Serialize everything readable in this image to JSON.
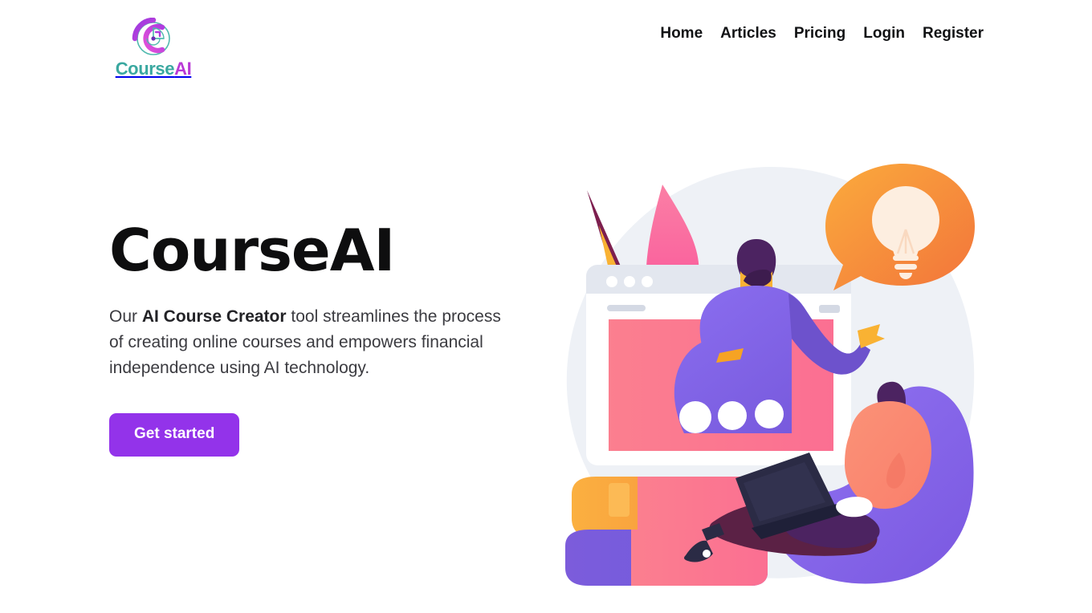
{
  "brand": {
    "logo_icon": "courseai-circular-logo-icon",
    "word_primary": "Course",
    "word_accent": "AI",
    "color_primary": "#3aa8a0",
    "color_accent": "#b939d6"
  },
  "nav": {
    "items": [
      {
        "label": "Home"
      },
      {
        "label": "Articles"
      },
      {
        "label": "Pricing"
      },
      {
        "label": "Login"
      },
      {
        "label": "Register"
      }
    ]
  },
  "hero": {
    "title": "CourseAI",
    "paragraph_prefix": "Our ",
    "paragraph_bold": "AI Course Creator",
    "paragraph_suffix": " tool streamlines the process of creating online courses and empowers financial independence using AI technology.",
    "cta_label": "Get started",
    "cta_color": "#9333ea",
    "illustration": {
      "name": "online-course-creation-illustration",
      "backdrop_color": "#eef1f6",
      "elements": [
        "pencil",
        "paintbrush",
        "browser-window",
        "presenter-person",
        "lightbulb-speech-bubble",
        "stacked-books",
        "person-on-beanbag-with-laptop"
      ],
      "palette": {
        "purple": "#7c5cdb",
        "purple_light": "#8b6ef0",
        "pink": "#fb6f92",
        "pink_light": "#f98ca8",
        "orange": "#f89c34",
        "orange_deep": "#f2743b",
        "yellow": "#f9b233",
        "cream": "#fdeee0",
        "maroon": "#7d1f4f",
        "navy": "#2b2b45",
        "coral": "#fb8a72",
        "white": "#ffffff",
        "grey": "#d8dce6"
      }
    }
  }
}
